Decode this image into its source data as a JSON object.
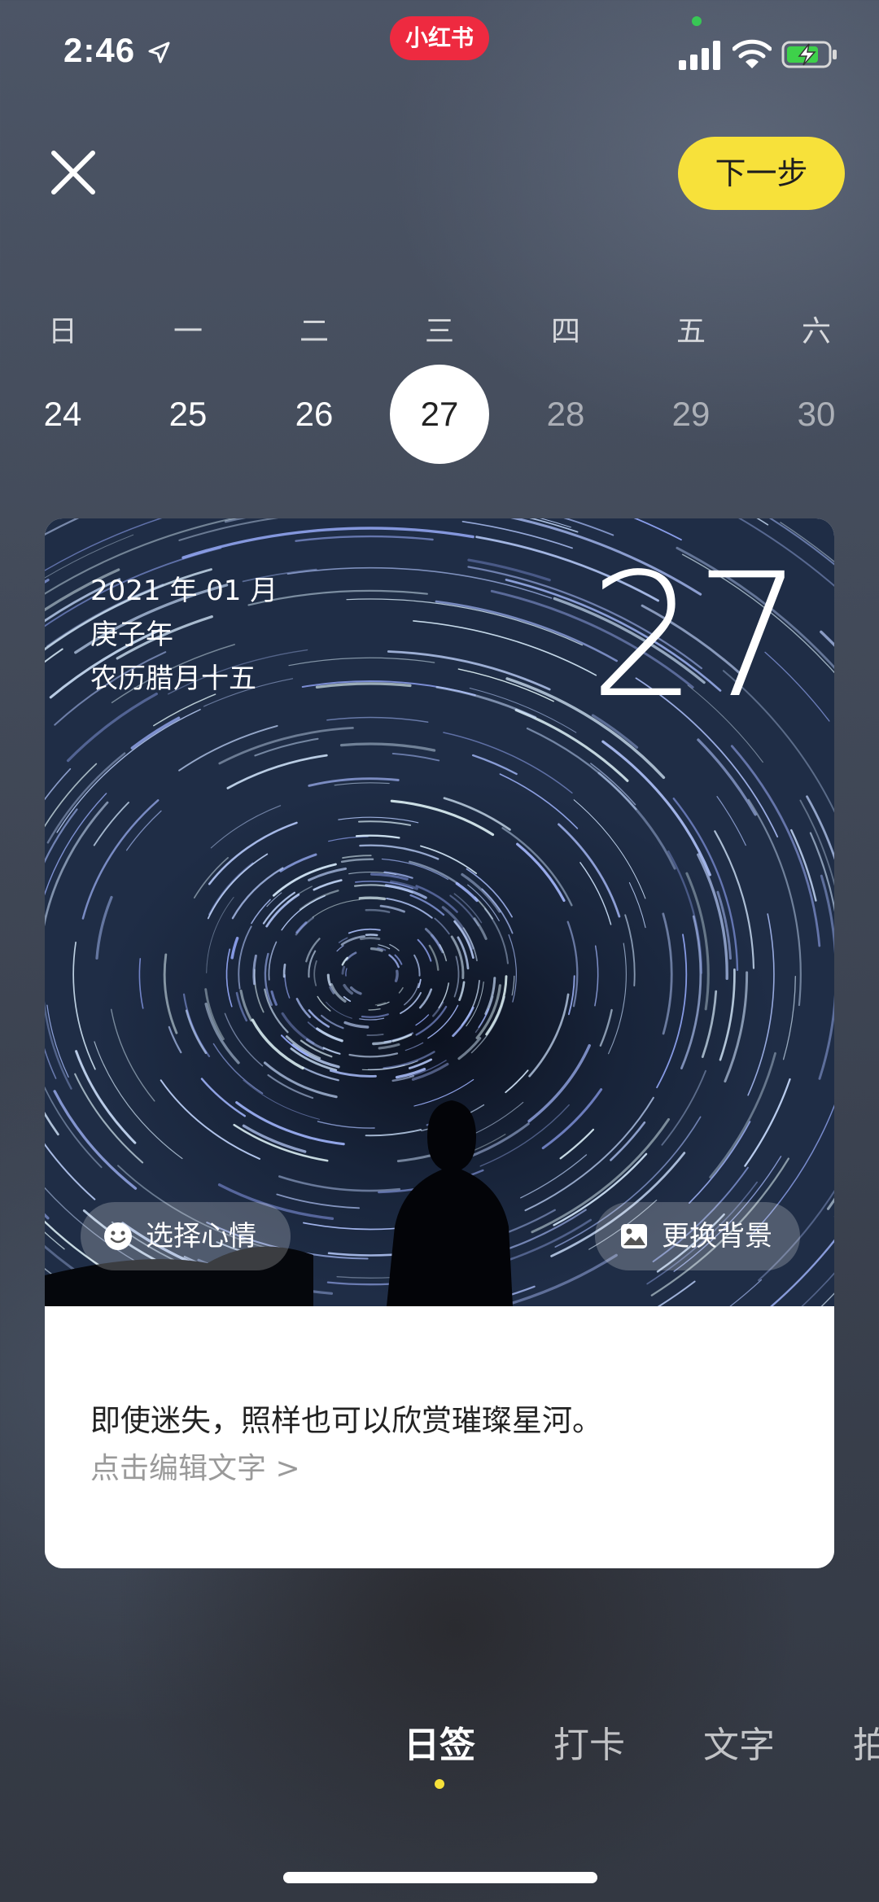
{
  "status_bar": {
    "time": "2:46",
    "app_badge": "小红书"
  },
  "header": {
    "next_label": "下一步"
  },
  "week": {
    "weekdays": [
      "日",
      "一",
      "二",
      "三",
      "四",
      "五",
      "六"
    ],
    "dates": [
      "24",
      "25",
      "26",
      "27",
      "28",
      "29",
      "30"
    ],
    "selected_index": 3
  },
  "card": {
    "year_month": "2021 年 01 月",
    "ganzhi_year": "庚子年",
    "lunar_date": "农历腊月十五",
    "day": "27",
    "mood_label": "选择心情",
    "background_label": "更换背景",
    "quote": "即使迷失，照样也可以欣赏璀璨星河。",
    "edit_hint": "点击编辑文字 >"
  },
  "tabs": [
    {
      "label": "日签",
      "active": true
    },
    {
      "label": "打卡",
      "active": false
    },
    {
      "label": "文字",
      "active": false
    },
    {
      "label": "拍",
      "active": false
    }
  ],
  "colors": {
    "accent_yellow": "#f7e13a",
    "app_red": "#ee2a40"
  }
}
